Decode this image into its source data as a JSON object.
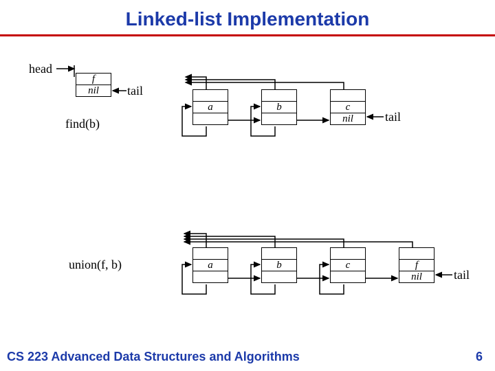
{
  "title": "Linked-list Implementation",
  "footer": {
    "course": "CS 223 Advanced Data Structures and Algorithms",
    "page": "6"
  },
  "labels": {
    "head": "head",
    "tail1": "tail",
    "tail2": "tail",
    "tail3": "tail",
    "findb": "find(b)",
    "unionfb": "union(f, b)"
  },
  "headnode": {
    "top": "f",
    "bottom": "nil"
  },
  "row1": {
    "a": {
      "mid": "a"
    },
    "b": {
      "mid": "b"
    },
    "c": {
      "mid": "c",
      "bot": "nil"
    }
  },
  "row2": {
    "a": {
      "mid": "a"
    },
    "b": {
      "mid": "b"
    },
    "c": {
      "mid": "c"
    },
    "f": {
      "mid": "f",
      "bot": "nil"
    }
  }
}
